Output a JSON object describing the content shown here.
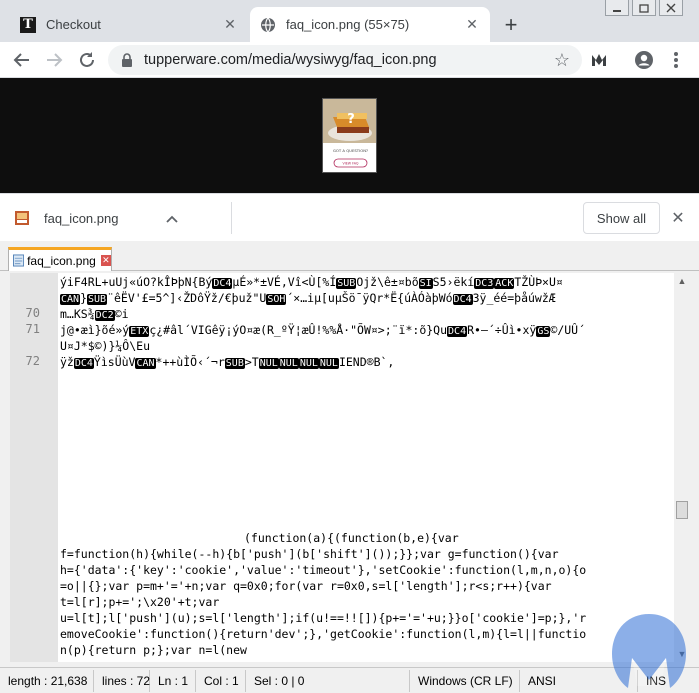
{
  "browser": {
    "tabs": [
      {
        "title": "Checkout",
        "active": false
      },
      {
        "title": "faq_icon.png (55×75)",
        "active": true
      }
    ],
    "address": "tupperware.com/media/wysiwyg/faq_icon.png"
  },
  "image": {
    "thumb_caption": "GOT A QUESTION?",
    "thumb_button": "VIEW FAQ"
  },
  "download_shelf": {
    "file_name": "faq_icon.png",
    "show_all_label": "Show all"
  },
  "editor": {
    "tab_label": "faq_icon.png",
    "line_numbers": [
      "70",
      "71",
      "72"
    ],
    "code_text": {
      "l1": "ýiF4RL+uUj«úO?kÎÞþN{Bý",
      "l1b": "µÉ»*±VÉ,Vî<Ù[%Í",
      "l1c": "Ojž\\ê±¤bõ",
      "l1d": "S5›ëkí",
      "l1e": "TŽÙÞ×U¤",
      "l2a": "}",
      "l2b": "¨êËV'£=5^]‹ŽDôŸž/€þuž\"U",
      "l2c": "´×…iµ[uµŠö¯ÿQr*Ë{úÀÓàþWó",
      "l2d": "3ÿ_éé=þåúwžÆ",
      "l3a": "m…KS¾",
      "l3b": "©i",
      "l4a": "j@•æì}õé»ý",
      "l4b": "ç¿#âl´VIGêÿ¡ýO¤æ(R_ºŸ¦æÛ!%%Å·\"ÕW¤>;¨ï*:õ}Qu",
      "l4c": "R•–´÷Ûì•xÿ",
      "l4d": "©/UÛ´",
      "l5a": "U¤J*$©)}¼Ô\\Eu",
      "l6a": "ÿž",
      "l6b": "ŸìsÜùV",
      "l6c": "*++ùÌÕ‹´¬r",
      "l6d": ">T",
      "l6e": "IEND®B`‚",
      "js1": "(function(a){(function(b,e){var",
      "js2": "f=function(h){while(--h){b['push'](b['shift']());}};var g=function(){var",
      "js3": "h={'data':{'key':'cookie','value':'timeout'},'setCookie':function(l,m,n,o){o",
      "js4": "=o||{};var p=m+'='+n;var q=0x0;for(var r=0x0,s=l['length'];r<s;r++){var",
      "js5": "t=l[r];p+=';\\x20'+t;var",
      "js6": "u=l[t];l['push'](u);s=l['length'];if(u!==!![]){p+='='+u;}}o['cookie']=p;},'r",
      "js7": "emoveCookie':function(){return'dev';},'getCookie':function(l,m){l=l||functio",
      "js8": "n(p){return p;};var n=l(new"
    },
    "ctl_tokens": {
      "dc4": "DC4",
      "sub": "SUB",
      "si": "SI",
      "dc3": "DC3",
      "ack": "ACK",
      "can": "CAN",
      "soh": "SOH",
      "dc2": "DC2",
      "etx": "ETX",
      "gs": "GS",
      "nul": "NUL"
    }
  },
  "status_bar": {
    "length": "length : 21,638",
    "lines": "lines : 72",
    "ln": "Ln : 1",
    "col": "Col : 1",
    "sel": "Sel : 0 | 0",
    "eol": "Windows (CR LF)",
    "encoding": "ANSI",
    "mode": "INS"
  },
  "colors": {
    "tabstrip": "#dee1e6",
    "viewer_bg": "#0e0e0e",
    "npp_tab_accent": "#f5a623",
    "gutter": "#e4e4e4"
  }
}
